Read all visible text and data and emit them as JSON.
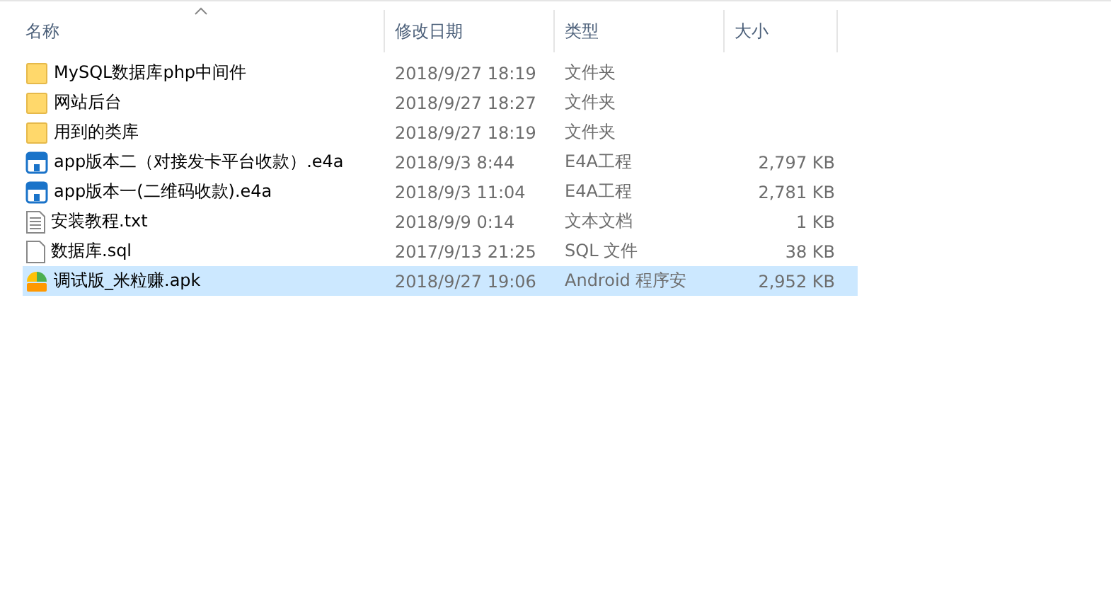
{
  "columns": [
    {
      "label": "名称",
      "sorted": true
    },
    {
      "label": "修改日期",
      "sorted": false
    },
    {
      "label": "类型",
      "sorted": false
    },
    {
      "label": "大小",
      "sorted": false
    }
  ],
  "files": [
    {
      "kind": "folder",
      "name": "MySQL数据库php中间件",
      "date": "2018/9/27 18:19",
      "type": "文件夹",
      "selected": false
    },
    {
      "kind": "folder",
      "name": "网站后台",
      "date": "2018/9/27 18:27",
      "type": "文件夹",
      "selected": false
    },
    {
      "kind": "folder",
      "name": "用到的类库",
      "date": "2018/9/27 18:19",
      "type": "文件夹",
      "selected": false
    },
    {
      "kind": "e4a",
      "name": "app版本二（对接发卡平台收款）.e4a",
      "date": "2018/9/3 8:44",
      "type": "E4A工程",
      "size": "2,797 KB",
      "selected": false
    },
    {
      "kind": "e4a",
      "name": "app版本一(二维码收款).e4a",
      "date": "2018/9/3 11:04",
      "type": "E4A工程",
      "size": "2,781 KB",
      "selected": false
    },
    {
      "kind": "text",
      "name": "安装教程.txt",
      "date": "2018/9/9 0:14",
      "type": "文本文档",
      "size": "1 KB",
      "selected": false
    },
    {
      "kind": "file",
      "name": "数据库.sql",
      "date": "2017/9/13 21:25",
      "type": "SQL 文件",
      "size": "38 KB",
      "selected": false
    },
    {
      "kind": "apk",
      "name": "调试版_米粒赚.apk",
      "date": "2018/9/27 19:06",
      "type": "Android 程序安",
      "size": "2,952 KB",
      "selected": true
    }
  ]
}
